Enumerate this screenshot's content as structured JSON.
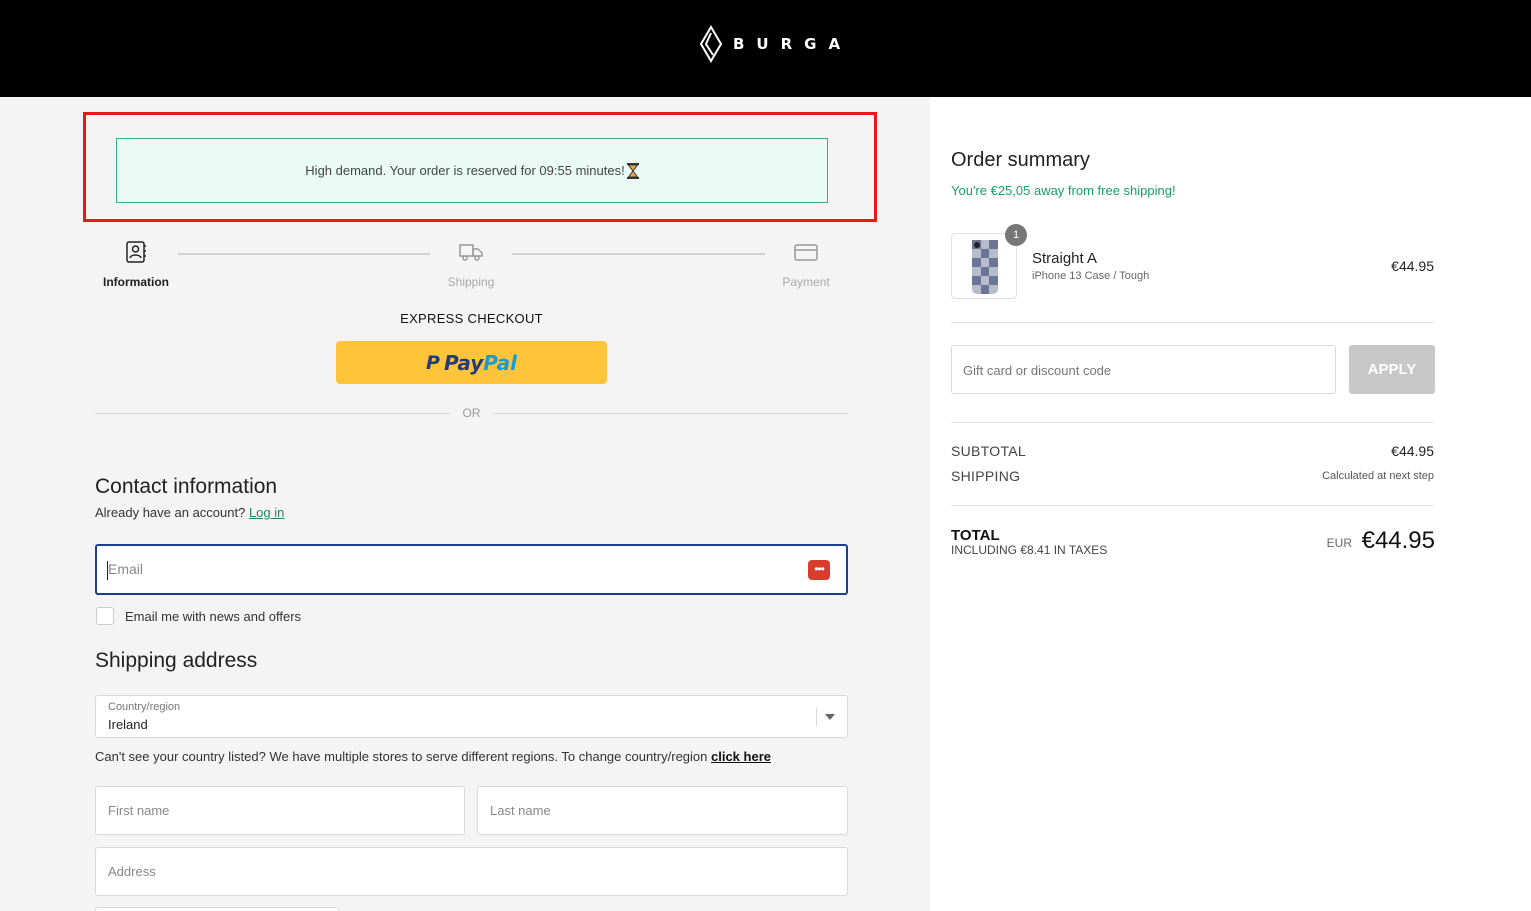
{
  "brand": {
    "name": "BURGA"
  },
  "banner": {
    "text": "High demand. Your order is reserved for 09:55 minutes!",
    "icon": "hourglass-icon"
  },
  "steps": [
    {
      "label": "Information",
      "icon": "contact-card-icon",
      "active": true
    },
    {
      "label": "Shipping",
      "icon": "truck-icon",
      "active": false
    },
    {
      "label": "Payment",
      "icon": "credit-card-icon",
      "active": false
    }
  ],
  "express": {
    "title": "EXPRESS CHECKOUT",
    "paypal_part1": "Pay",
    "paypal_part2": "Pal",
    "or": "OR"
  },
  "contact": {
    "title": "Contact information",
    "account_prompt": "Already have an account?",
    "login_link": "Log in",
    "email_placeholder": "Email",
    "newsletter_label": "Email me with news and offers"
  },
  "shipping": {
    "title": "Shipping address",
    "country_label": "Country/region",
    "country_value": "Ireland",
    "note": "Can't see your country listed? We have multiple stores to serve different regions. To change country/region",
    "note_link": "click here",
    "first_name_placeholder": "First name",
    "last_name_placeholder": "Last name",
    "address_placeholder": "Address"
  },
  "summary": {
    "title": "Order summary",
    "free_shipping": "You're €25,05 away from free shipping!",
    "item": {
      "quantity": "1",
      "name": "Straight A",
      "variant": "iPhone 13 Case / Tough",
      "price": "€44.95"
    },
    "gift_placeholder": "Gift card or discount code",
    "apply_label": "APPLY",
    "subtotal_label": "SUBTOTAL",
    "subtotal_value": "€44.95",
    "shipping_label": "SHIPPING",
    "shipping_value": "Calculated at next step",
    "total_label": "TOTAL",
    "tax_note": "INCLUDING €8.41 IN TAXES",
    "currency": "EUR",
    "total_value": "€44.95"
  },
  "colors": {
    "accent": "#1a9f6a",
    "banner_bg": "#e9fbf4",
    "paypal": "#ffc439",
    "focus": "#1b3f8f",
    "highlight": "#e41b1b"
  }
}
